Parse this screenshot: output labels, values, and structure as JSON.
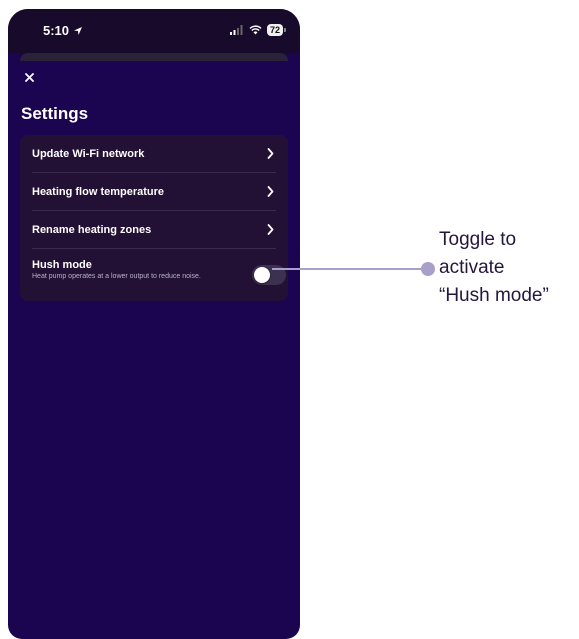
{
  "status_bar": {
    "time": "5:10",
    "battery": "72",
    "icons": [
      "location-arrow-icon",
      "signal-icon",
      "wifi-icon",
      "battery-icon"
    ]
  },
  "header": {
    "close_icon": "close-icon",
    "title": "Settings"
  },
  "settings": {
    "items": [
      {
        "label": "Update Wi-Fi network",
        "icon": "chevron-right-icon"
      },
      {
        "label": "Heating flow temperature",
        "icon": "chevron-right-icon"
      },
      {
        "label": "Rename heating zones",
        "icon": "chevron-right-icon"
      }
    ],
    "hush_mode": {
      "title": "Hush mode",
      "description": "Heat pump operates at a lower output to reduce noise.",
      "toggle_on": false
    }
  },
  "annotation": {
    "line1": "Toggle to",
    "line2": "activate",
    "line3": "“Hush mode”"
  },
  "colors": {
    "app_background": "#1b0551",
    "card": "#231135",
    "callout": "#a8a0c8",
    "annotation_text": "#23173e"
  }
}
